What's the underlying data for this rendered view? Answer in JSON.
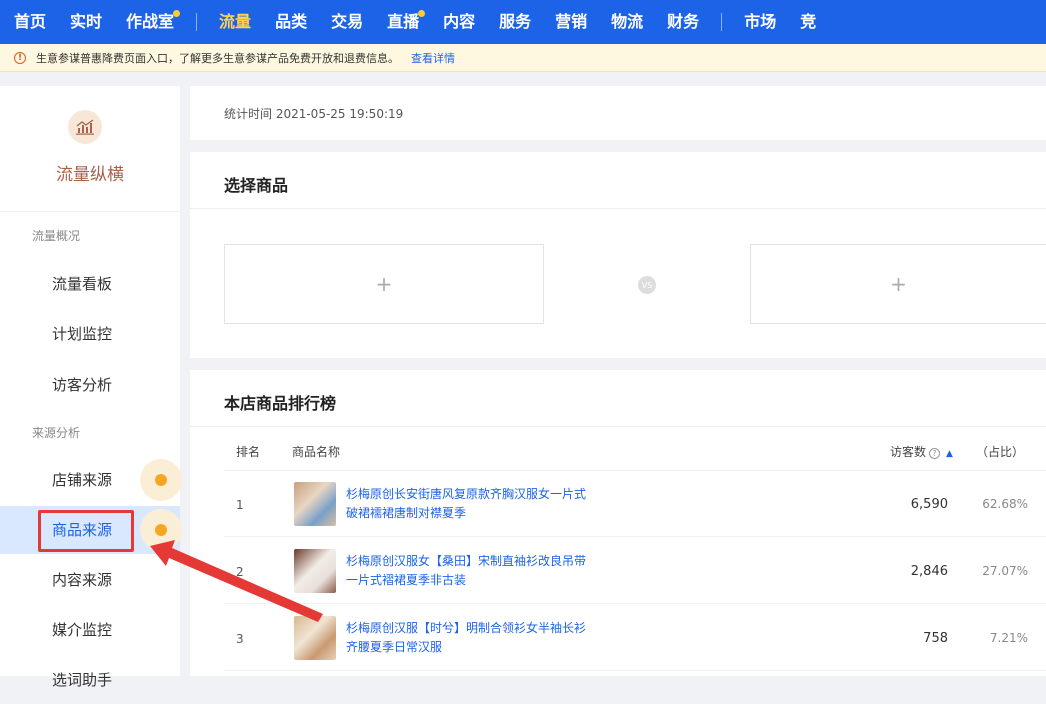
{
  "topnav": {
    "items": [
      {
        "label": "首页"
      },
      {
        "label": "实时"
      },
      {
        "label": "作战室"
      },
      {
        "label": "流量"
      },
      {
        "label": "品类"
      },
      {
        "label": "交易"
      },
      {
        "label": "直播"
      },
      {
        "label": "内容"
      },
      {
        "label": "服务"
      },
      {
        "label": "营销"
      },
      {
        "label": "物流"
      },
      {
        "label": "财务"
      },
      {
        "label": "市场"
      },
      {
        "label": "竞"
      }
    ],
    "active_label": "流量",
    "text_color": "#ffffff",
    "active_color": "#ffd34d",
    "background": "#1d63e8"
  },
  "notice": {
    "icon": "warning-circle-icon",
    "text": "生意参谋普惠降费页面入口，了解更多生意参谋产品免费开放和退费信息。",
    "link": "查看详情"
  },
  "sidebar": {
    "logo_icon": "chart-icon",
    "title": "流量纵横",
    "groups": [
      {
        "label": "流量概况"
      },
      {
        "label": "来源分析"
      }
    ],
    "items": [
      {
        "label": "流量看板"
      },
      {
        "label": "计划监控"
      },
      {
        "label": "访客分析"
      },
      {
        "label": "店铺来源"
      },
      {
        "label": "商品来源"
      },
      {
        "label": "内容来源"
      },
      {
        "label": "媒介监控"
      },
      {
        "label": "选词助手"
      }
    ],
    "active_label": "商品来源",
    "active_background": "#d9e8ff",
    "highlight_color": "#e53935",
    "badge_color": "#f5a623"
  },
  "stats": {
    "time_label": "统计时间 2021-05-25 19:50:19"
  },
  "select_product": {
    "title": "选择商品",
    "add_symbol": "+",
    "vs_label": "VS"
  },
  "ranking": {
    "title": "本店商品排行榜",
    "columns": {
      "rank": "排名",
      "name": "商品名称",
      "visitors": "访客数",
      "ratio": "（占比）"
    },
    "rows": [
      {
        "rank": "1",
        "name": "杉梅原创长安街唐风复原款齐胸汉服女一片式破裙襦裙唐制对襟夏季",
        "visitors": "6,590",
        "ratio": "62.68%"
      },
      {
        "rank": "2",
        "name": "杉梅原创汉服女【桑田】宋制直袖衫改良吊带一片式褶裙夏季非古装",
        "visitors": "2,846",
        "ratio": "27.07%"
      },
      {
        "rank": "3",
        "name": "杉梅原创汉服【时兮】明制合领衫女半袖长衫齐腰夏季日常汉服",
        "visitors": "758",
        "ratio": "7.21%"
      }
    ]
  }
}
